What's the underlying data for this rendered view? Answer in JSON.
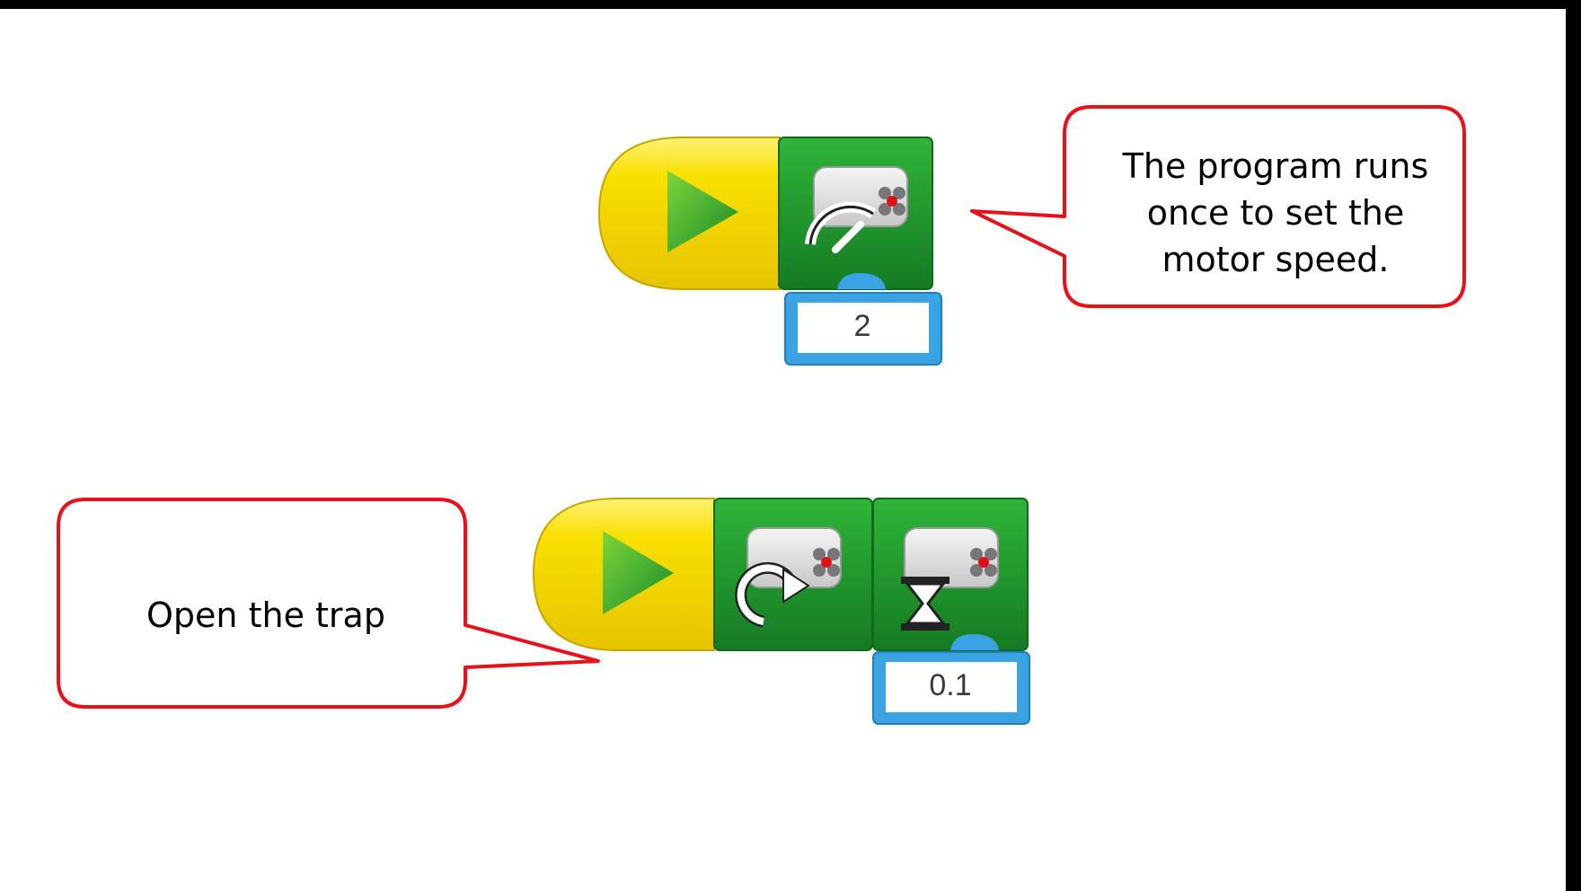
{
  "callouts": {
    "top": "The program runs once to set the motor speed.",
    "top_lines": [
      "The program runs",
      "once to set the",
      "motor speed."
    ],
    "bottom": "Open the trap"
  },
  "programs": [
    {
      "blocks": [
        {
          "type": "start",
          "icon": "play-icon"
        },
        {
          "type": "motor-power",
          "icon": "motor-speed-gauge-icon",
          "parameter": "2"
        }
      ]
    },
    {
      "blocks": [
        {
          "type": "start",
          "icon": "play-icon"
        },
        {
          "type": "motor-direction",
          "icon": "motor-rotate-icon"
        },
        {
          "type": "motor-on-for",
          "icon": "motor-hourglass-icon",
          "parameter": "0.1"
        }
      ]
    }
  ],
  "colors": {
    "callout_border": "#e8101a",
    "start_block": "#f7dc00",
    "action_block": "#1f9a2c",
    "parameter_border": "#3aa3e3"
  }
}
